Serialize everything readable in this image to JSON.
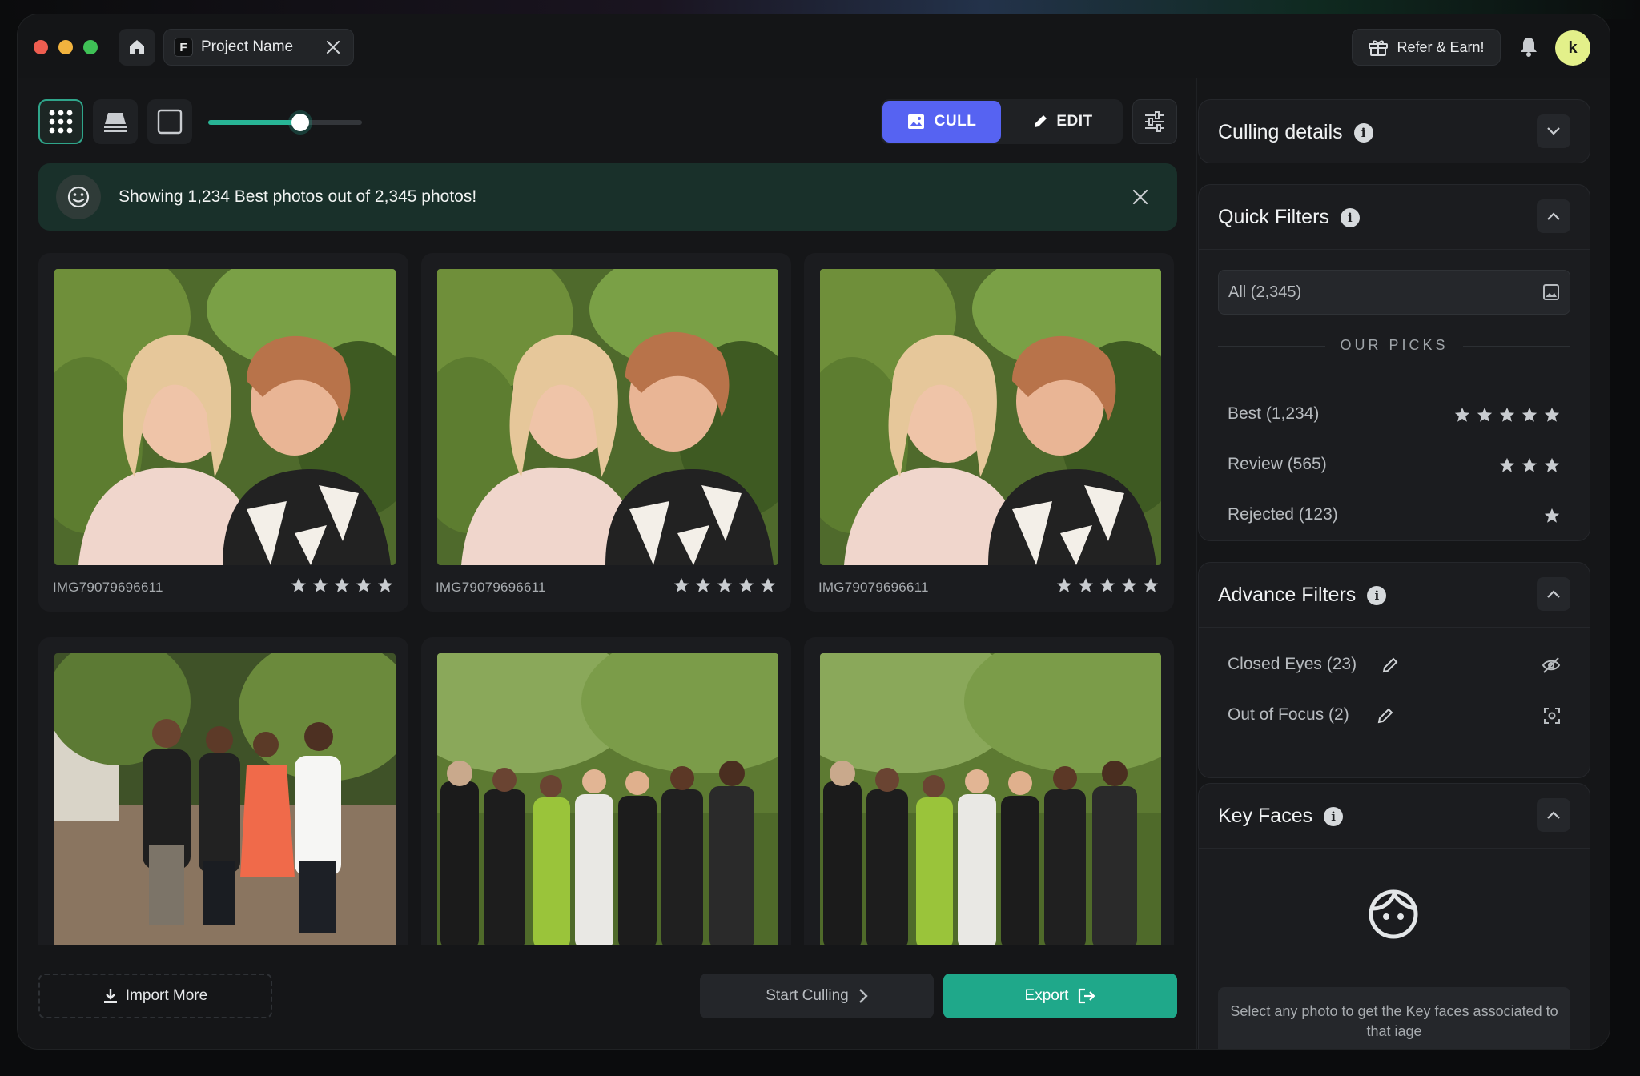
{
  "window": {
    "project_tab": {
      "logo_letter": "F",
      "name": "Project Name"
    },
    "refer_label": "Refer & Earn!",
    "avatar_initial": "k"
  },
  "toolbar": {
    "zoom_level": 0.6,
    "modes": {
      "cull_label": "CULL",
      "edit_label": "EDIT",
      "active": "CULL"
    }
  },
  "banner": {
    "text": "Showing 1,234 Best photos out of 2,345 photos!"
  },
  "photos": [
    {
      "filename": "IMG79079696611",
      "rating": 5
    },
    {
      "filename": "IMG79079696611",
      "rating": 5
    },
    {
      "filename": "IMG79079696611",
      "rating": 5
    },
    {
      "filename": "",
      "rating": null
    },
    {
      "filename": "",
      "rating": null
    },
    {
      "filename": "",
      "rating": null
    }
  ],
  "bottom_bar": {
    "import_label": "Import More",
    "start_culling_label": "Start Culling",
    "export_label": "Export"
  },
  "panel": {
    "culling_details": {
      "title": "Culling details",
      "expanded": false
    },
    "quick_filters": {
      "title": "Quick Filters",
      "all_label": "All (2,345)",
      "picks_heading": "OUR PICKS",
      "picks": [
        {
          "label": "Best (1,234)",
          "stars": 5
        },
        {
          "label": "Review (565)",
          "stars": 3
        },
        {
          "label": "Rejected (123)",
          "stars": 1
        }
      ]
    },
    "advance_filters": {
      "title": "Advance Filters",
      "items": [
        {
          "label": "Closed Eyes (23)",
          "icon": "eye-off-icon"
        },
        {
          "label": "Out of Focus (2)",
          "icon": "focus-frame-icon"
        }
      ]
    },
    "key_faces": {
      "title": "Key Faces",
      "note": "Select any photo to get the Key faces associated to that iage"
    }
  },
  "colors": {
    "accent_green": "#1fa88a",
    "cull_blue": "#5663f2",
    "banner_bg": "#19302a",
    "avatar_bg": "#e3f08a"
  }
}
